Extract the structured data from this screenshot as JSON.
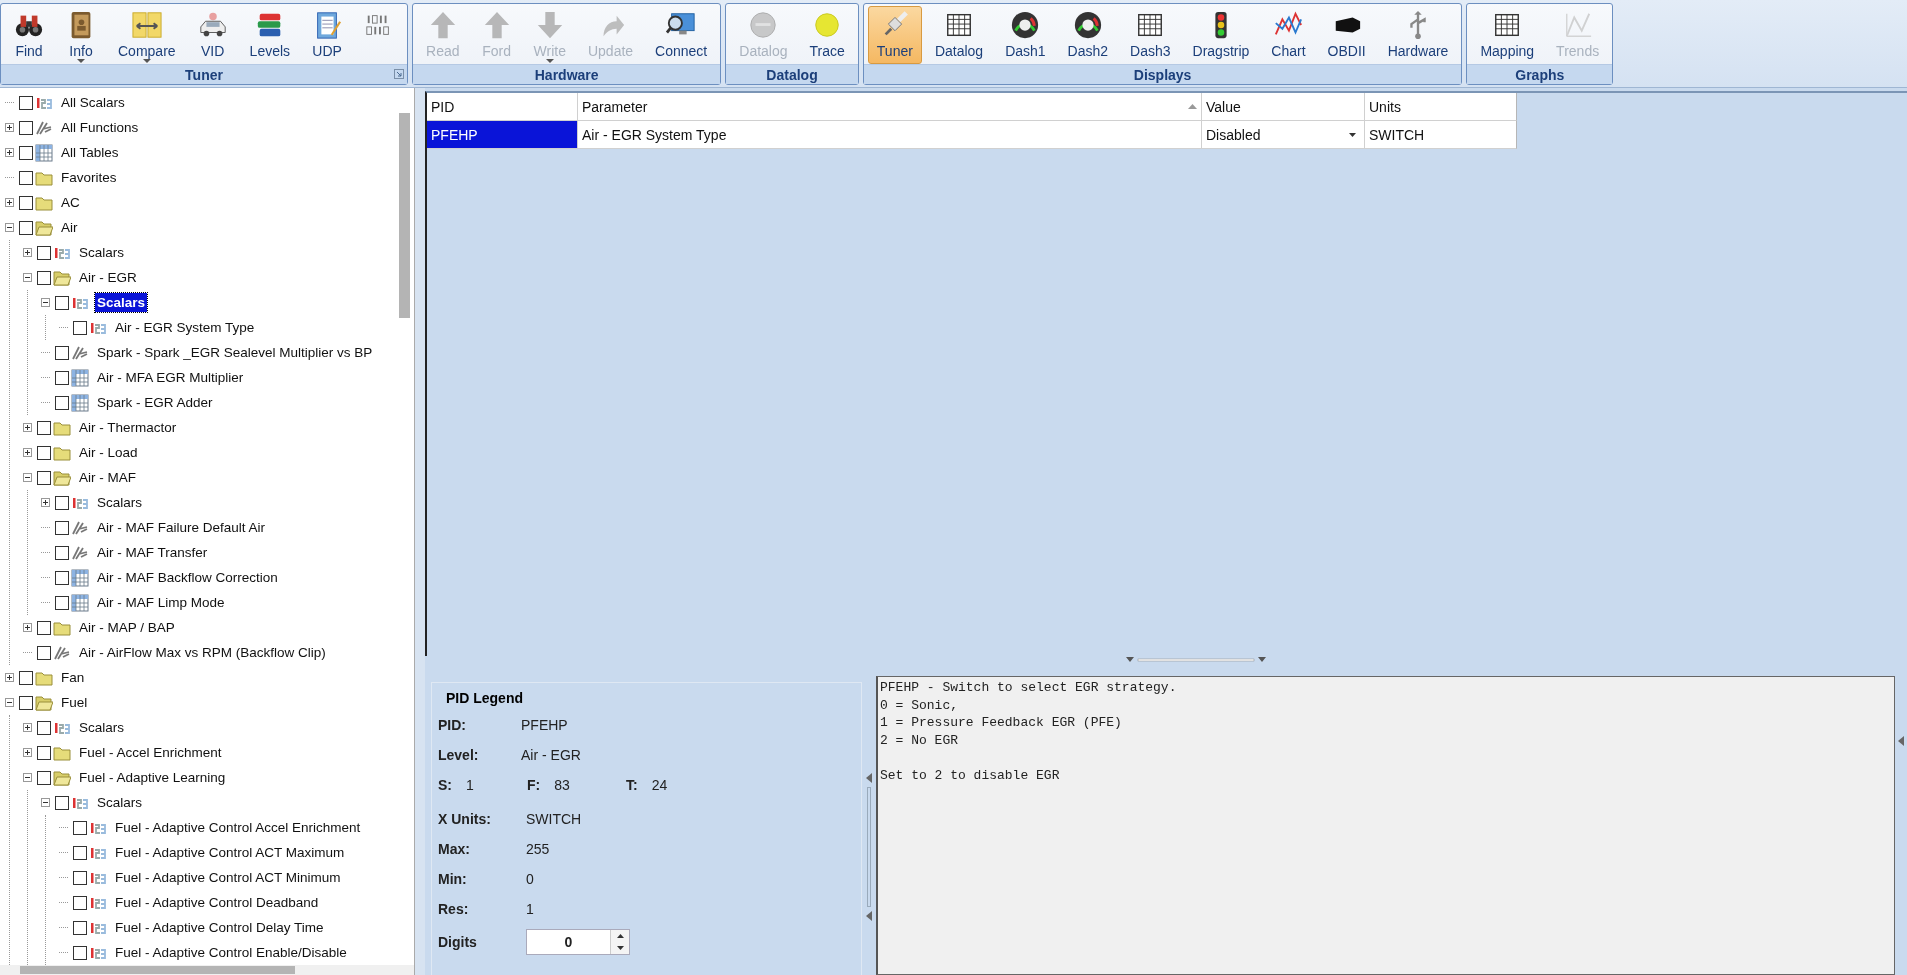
{
  "ribbon": {
    "groups": [
      {
        "title": "Tuner",
        "launcher": true,
        "buttons": [
          {
            "label": "Find",
            "disabled": false,
            "dropdown": false
          },
          {
            "label": "Info",
            "disabled": false,
            "dropdown": true
          },
          {
            "label": "Compare",
            "disabled": false,
            "dropdown": true
          },
          {
            "label": "VID",
            "disabled": false,
            "dropdown": false
          },
          {
            "label": "Levels",
            "disabled": false,
            "dropdown": false
          },
          {
            "label": "UDP",
            "disabled": false,
            "dropdown": false
          },
          {
            "disabled": false,
            "dropdown": false
          }
        ]
      },
      {
        "title": "Hardware",
        "launcher": false,
        "buttons": [
          {
            "label": "Read",
            "disabled": true,
            "dropdown": false
          },
          {
            "label": "Ford",
            "disabled": true,
            "dropdown": false
          },
          {
            "label": "Write",
            "disabled": true,
            "dropdown": true
          },
          {
            "label": "Update",
            "disabled": true,
            "dropdown": false
          },
          {
            "label": "Connect",
            "disabled": false,
            "dropdown": false
          }
        ]
      },
      {
        "title": "Datalog",
        "launcher": false,
        "buttons": [
          {
            "label": "Datalog",
            "disabled": true,
            "dropdown": false
          },
          {
            "label": "Trace",
            "disabled": false,
            "dropdown": false
          }
        ]
      },
      {
        "title": "Displays",
        "launcher": false,
        "buttons": [
          {
            "label": "Tuner",
            "disabled": false,
            "dropdown": false,
            "selected": true
          },
          {
            "label": "Datalog",
            "disabled": false,
            "dropdown": false,
            "selected": false
          },
          {
            "label": "Dash1",
            "disabled": false,
            "dropdown": false,
            "selected": false
          },
          {
            "label": "Dash2",
            "disabled": false,
            "dropdown": false,
            "selected": false
          },
          {
            "label": "Dash3",
            "disabled": false,
            "dropdown": false,
            "selected": false
          },
          {
            "label": "Dragstrip",
            "disabled": false,
            "dropdown": false,
            "selected": false
          },
          {
            "label": "Chart",
            "disabled": false,
            "dropdown": false,
            "selected": false
          },
          {
            "label": "OBDII",
            "disabled": false,
            "dropdown": false,
            "selected": false
          },
          {
            "label": "Hardware",
            "disabled": false,
            "dropdown": false,
            "selected": false
          }
        ]
      },
      {
        "title": "Graphs",
        "launcher": false,
        "buttons": [
          {
            "label": "Mapping",
            "disabled": false,
            "dropdown": false
          },
          {
            "label": "Trends",
            "disabled": true,
            "dropdown": false
          }
        ]
      }
    ]
  },
  "tree": [
    {
      "label": "All Scalars",
      "kind": "scalar",
      "checked": false,
      "selected": false
    },
    {
      "label": "All Functions",
      "kind": "function",
      "checked": false,
      "selected": false,
      "expanded": false
    },
    {
      "label": "All Tables",
      "kind": "table",
      "checked": false,
      "selected": false,
      "expanded": false
    },
    {
      "label": "Favorites",
      "kind": "folder",
      "checked": false,
      "selected": false
    },
    {
      "label": "AC",
      "kind": "folder",
      "checked": false,
      "selected": false,
      "expanded": false
    },
    {
      "label": "Air",
      "kind": "folder",
      "checked": false,
      "selected": false,
      "expanded": true,
      "children": [
        {
          "label": "Scalars",
          "kind": "scalar",
          "checked": false,
          "selected": false,
          "expanded": false
        },
        {
          "label": "Air - EGR",
          "kind": "folder",
          "checked": false,
          "selected": false,
          "expanded": true,
          "children": [
            {
              "label": "Scalars",
              "kind": "scalar",
              "checked": false,
              "selected": true,
              "expanded": true,
              "children": [
                {
                  "label": "Air - EGR System Type",
                  "kind": "scalar",
                  "checked": false,
                  "selected": false
                }
              ]
            },
            {
              "label": "Spark - Spark _EGR Sealevel Multiplier vs BP",
              "kind": "function",
              "checked": false,
              "selected": false
            },
            {
              "label": "Air - MFA EGR Multiplier",
              "kind": "table",
              "checked": false,
              "selected": false
            },
            {
              "label": "Spark - EGR Adder",
              "kind": "table",
              "checked": false,
              "selected": false
            }
          ]
        },
        {
          "label": "Air - Thermactor",
          "kind": "folder",
          "checked": false,
          "selected": false,
          "expanded": false
        },
        {
          "label": "Air - Load",
          "kind": "folder",
          "checked": false,
          "selected": false,
          "expanded": false
        },
        {
          "label": "Air - MAF",
          "kind": "folder",
          "checked": false,
          "selected": false,
          "expanded": true,
          "children": [
            {
              "label": "Scalars",
              "kind": "scalar",
              "checked": false,
              "selected": false,
              "expanded": false
            },
            {
              "label": "Air - MAF Failure Default Air",
              "kind": "function",
              "checked": false,
              "selected": false
            },
            {
              "label": "Air - MAF Transfer",
              "kind": "function",
              "checked": false,
              "selected": false
            },
            {
              "label": "Air - MAF Backflow Correction",
              "kind": "table",
              "checked": false,
              "selected": false
            },
            {
              "label": "Air - MAF Limp Mode",
              "kind": "table",
              "checked": false,
              "selected": false
            }
          ]
        },
        {
          "label": "Air - MAP / BAP",
          "kind": "folder",
          "checked": false,
          "selected": false,
          "expanded": false
        },
        {
          "label": "Air - AirFlow Max vs RPM (Backflow Clip)",
          "kind": "function",
          "checked": false,
          "selected": false
        }
      ]
    },
    {
      "label": "Fan",
      "kind": "folder",
      "checked": false,
      "selected": false,
      "expanded": false
    },
    {
      "label": "Fuel",
      "kind": "folder",
      "checked": false,
      "selected": false,
      "expanded": true,
      "children": [
        {
          "label": "Scalars",
          "kind": "scalar",
          "checked": false,
          "selected": false,
          "expanded": false
        },
        {
          "label": "Fuel - Accel Enrichment",
          "kind": "folder",
          "checked": false,
          "selected": false,
          "expanded": false
        },
        {
          "label": "Fuel - Adaptive Learning",
          "kind": "folder",
          "checked": false,
          "selected": false,
          "expanded": true,
          "children": [
            {
              "label": "Scalars",
              "kind": "scalar",
              "checked": false,
              "selected": false,
              "expanded": true,
              "children": [
                {
                  "label": "Fuel - Adaptive Control Accel Enrichment",
                  "kind": "scalar",
                  "checked": false,
                  "selected": false
                },
                {
                  "label": "Fuel - Adaptive Control ACT Maximum",
                  "kind": "scalar",
                  "checked": false,
                  "selected": false
                },
                {
                  "label": "Fuel - Adaptive Control ACT Minimum",
                  "kind": "scalar",
                  "checked": false,
                  "selected": false
                },
                {
                  "label": "Fuel - Adaptive Control Deadband",
                  "kind": "scalar",
                  "checked": false,
                  "selected": false
                },
                {
                  "label": "Fuel - Adaptive Control Delay Time",
                  "kind": "scalar",
                  "checked": false,
                  "selected": false
                },
                {
                  "label": "Fuel - Adaptive Control Enable/Disable",
                  "kind": "scalar",
                  "checked": false,
                  "selected": false
                }
              ]
            }
          ]
        }
      ]
    }
  ],
  "table": {
    "columns": [
      {
        "label": "PID",
        "sorted": false
      },
      {
        "label": "Parameter",
        "sorted": true
      },
      {
        "label": "Value",
        "sorted": false
      },
      {
        "label": "Units",
        "sorted": false
      }
    ],
    "rows": [
      {
        "pid": "PFEHP",
        "parameter": "Air - EGR System Type",
        "value": "Disabled",
        "units": "SWITCH",
        "selected": true
      }
    ]
  },
  "legend": {
    "title": "PID Legend",
    "pid_label": "PID:",
    "pid": "PFEHP",
    "level_label": "Level:",
    "level_value": "Air - EGR",
    "s_label": "S:",
    "s": "1",
    "f_label": "F:",
    "f": "83",
    "t_label": "T:",
    "t": "24",
    "fields": [
      {
        "label": "X Units:",
        "value": "SWITCH"
      },
      {
        "label": "Max:",
        "value": "255"
      },
      {
        "label": "Min:",
        "value": "0"
      },
      {
        "label": "Res:",
        "value": "1"
      }
    ],
    "digits_label": "Digits",
    "digits": "0"
  },
  "description": [
    [
      "PFEHP - Switch to select EGR strategy.",
      "0 = Sonic,",
      "1 = Pressure Feedback EGR (PFE)",
      "2 = No EGR"
    ],
    [
      "Set to 2 to disable EGR"
    ]
  ]
}
